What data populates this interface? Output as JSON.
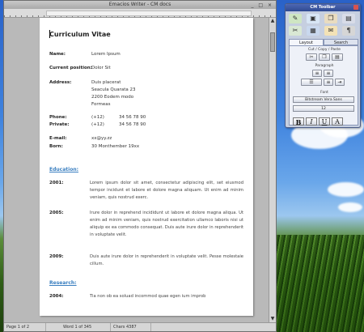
{
  "writer": {
    "title": "Emacios Writer - CM docs",
    "title_buttons": "_ □ ×",
    "cv_title": "Curriculum Vitae",
    "name_label": "Name:",
    "name_value": "Lorem Ipsum",
    "position_label": "Current position:",
    "position_value": "Dolor Sit",
    "address_label": "Address:",
    "address_lines": [
      "Duis placerat",
      "Seacula Quarata 23",
      "2200 Eodem modo",
      "Formeas"
    ],
    "phone_label": "Phone:",
    "phone_code": "(+12)",
    "phone_number": "34 56 78 90",
    "private_label": "Private:",
    "private_code": "(+12)",
    "private_number": "34 56 78 90",
    "email_label": "E-mail:",
    "email_value": "xx@yy.zz",
    "born_label": "Born:",
    "born_value": "30 Monthember 19xx",
    "education_heading": "Education:",
    "entries": [
      {
        "year": "2001:",
        "text": "Lorem ipsum dolor sit amet, consectetur adipiscing elit, set eiusmod tempor incidunt et labore et dolore magna aliquam. Ut enim ad minim veniam, quis nostrud exerc."
      },
      {
        "year": "2005:",
        "text": "Irure dolor in reprehend incididunt ut labore et dolore magna aliqua. Ut enim ad minim veniam, quis nostrud exercitation ullamco laboris nisi ut aliquip ex ea commodo consequat. Duis aute irure dolor in reprehenderit in voluptate velit."
      },
      {
        "year": "2009:",
        "text": "Duis aute irure dolor in reprehenderit in voluptate velit. Pesse molestaie cillum."
      }
    ],
    "research_heading": "Research:",
    "research_entry": {
      "year": "2004:",
      "text": "Tia non ob ea soluad incommod quae egen ium improb"
    },
    "status": {
      "page": "Page 1 of 2",
      "words": "Word 1 of 345",
      "chars": "Chars 4387"
    }
  },
  "toolbar": {
    "title": "CM Toolbar",
    "tabs": [
      "Layout",
      "Search"
    ],
    "cut_copy_paste": "Cut / Copy / Paste",
    "paragraph": "Paragraph",
    "font": "Font",
    "font_name": "Bitstream Vera Sans",
    "font_size": "12",
    "format_buttons": [
      "B",
      "I",
      "U",
      "A"
    ]
  },
  "colors": {
    "section_heading": "#3a7fc0",
    "toolbar_title": "#2f4a92"
  }
}
